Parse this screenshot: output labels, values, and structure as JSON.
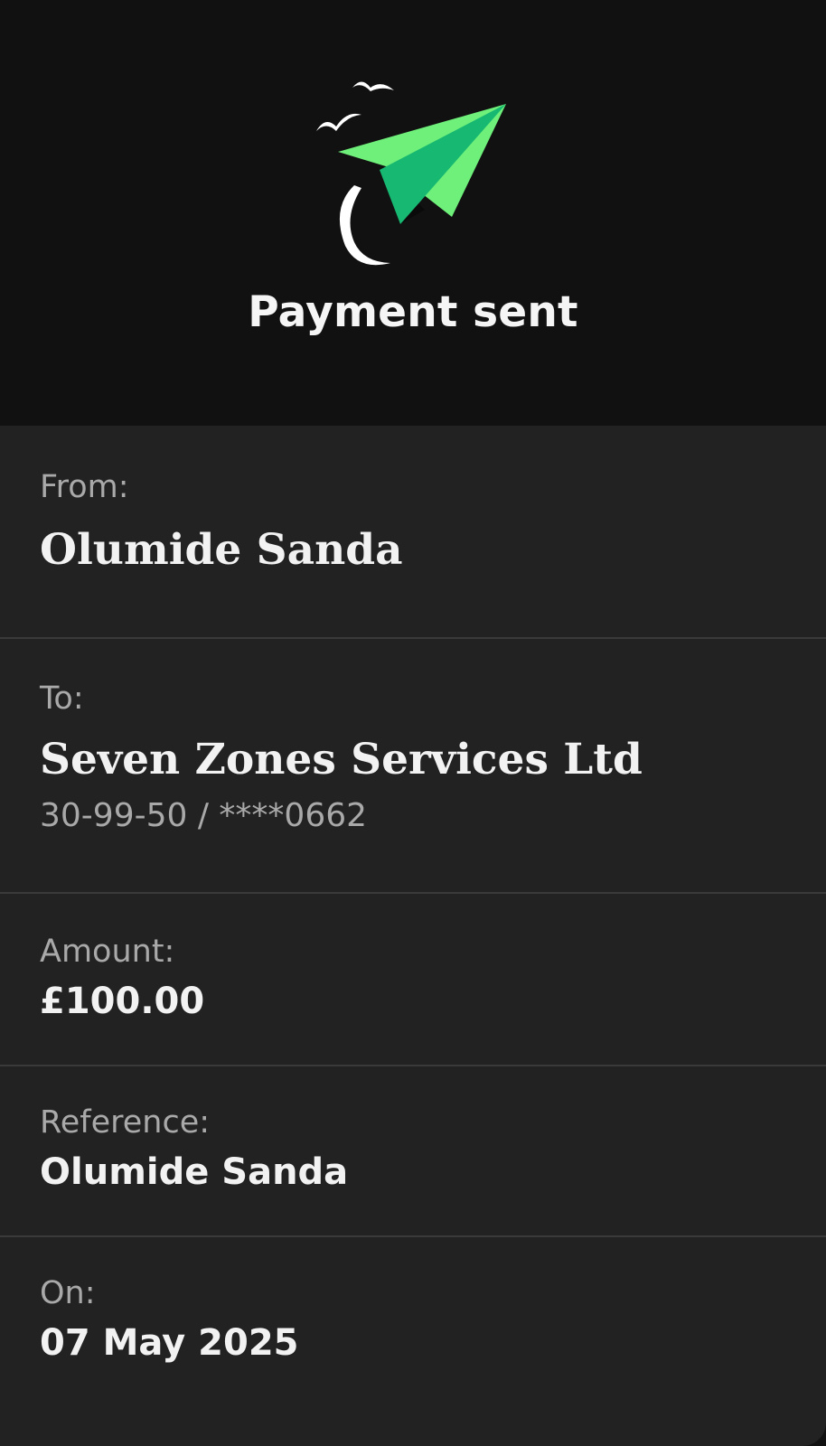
{
  "header": {
    "title": "Payment sent",
    "illustration": "paper-plane-icon",
    "accent_color": "#6ef07a",
    "accent_dark": "#17b871"
  },
  "details": {
    "from": {
      "label": "From:",
      "value": "Olumide Sanda"
    },
    "to": {
      "label": "To:",
      "value": "Seven Zones Services Ltd",
      "account": "30-99-50 / ****0662"
    },
    "amount": {
      "label": "Amount:",
      "value": "£100.00"
    },
    "reference": {
      "label": "Reference:",
      "value": "Olumide Sanda"
    },
    "date": {
      "label": "On:",
      "value": "07 May 2025"
    }
  }
}
